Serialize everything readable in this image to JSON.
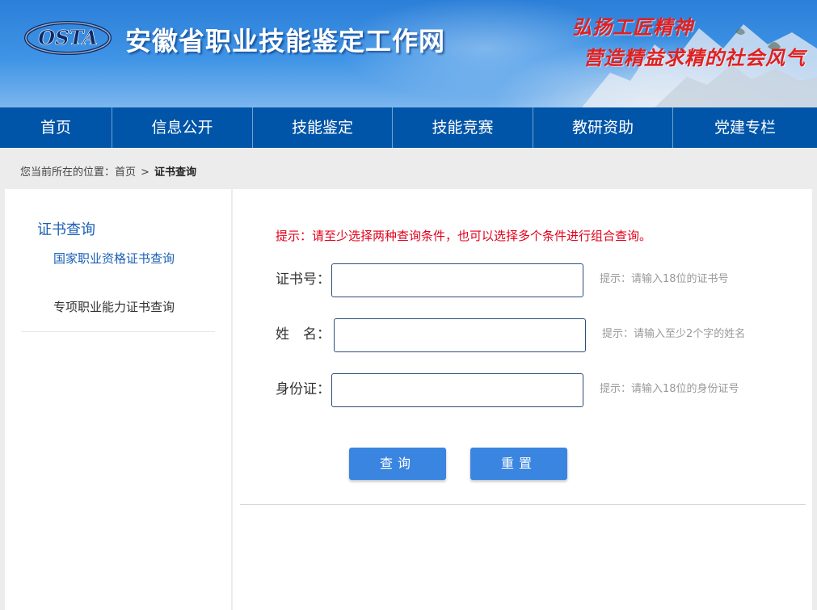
{
  "header": {
    "logo_text": "OSTA",
    "site_title": "安徽省职业技能鉴定工作网",
    "slogan_line1": "弘扬工匠精神",
    "slogan_line2": "营造精益求精的社会风气"
  },
  "nav": {
    "items": [
      "首页",
      "信息公开",
      "技能鉴定",
      "技能竞赛",
      "教研资助",
      "党建专栏"
    ]
  },
  "breadcrumb": {
    "prefix": "您当前所在的位置：",
    "home": "首页",
    "separator": ">",
    "current": "证书查询"
  },
  "sidebar": {
    "title": "证书查询",
    "items": [
      "国家职业资格证书查询",
      "专项职业能力证书查询"
    ]
  },
  "form": {
    "tip": "提示：请至少选择两种查询条件，也可以选择多个条件进行组合查询。",
    "cert_label": "证书号：",
    "cert_hint": "提示：请输入18位的证书号",
    "name_label": "姓　名：",
    "name_hint": "提示：请输入至少2个字的姓名",
    "id_label": "身份证：",
    "id_hint": "提示：请输入18位的身份证号",
    "search_button": "查询",
    "reset_button": "重置"
  },
  "colors": {
    "nav_bg": "#0055a8",
    "tip_red": "#e0001b",
    "button_blue": "#3a85e0",
    "sidebar_title": "#1a5fb4"
  }
}
